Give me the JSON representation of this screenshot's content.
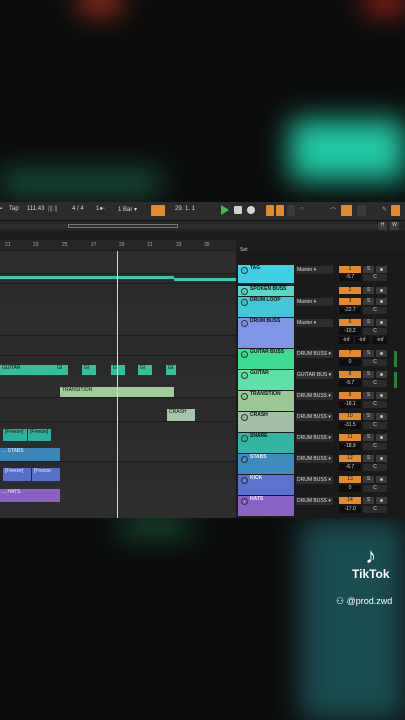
{
  "transport": {
    "tap": "Tap",
    "tempo": "111.43",
    "meter": "4 / 4",
    "quantize": "1 Bar",
    "position": "29.  1.  1"
  },
  "ruler": {
    "bars": [
      "21",
      "23",
      "25",
      "27",
      "29",
      "31",
      "33",
      "35"
    ]
  },
  "set_label": "Set",
  "clips": {
    "guitar": "GUITAR",
    "gi": "GI",
    "transition": "TRANSITION",
    "crash": "CRASH",
    "snare_a": "[Freeze]",
    "snare_b": "[Freeze]",
    "stabs": "... STABS",
    "kick_a": "[Freeze]",
    "kick_b": "[Freeze",
    "hats": "... HATS"
  },
  "tracks": [
    {
      "name": "TAG",
      "color": "#3fd0e6",
      "route": "Master",
      "num": "1",
      "vol": "-5.7",
      "pan": "C"
    },
    {
      "name": "SPOKEN BUSS",
      "color": "#57d7c6",
      "route": "",
      "num": "2",
      "vol": "",
      "pan": ""
    },
    {
      "name": "DRUM LOOP",
      "color": "#43c7d6",
      "route": "Master",
      "num": "3",
      "vol": "-22.7",
      "pan": "C"
    },
    {
      "name": "DRUM BUSS",
      "color": "#7f95e6",
      "route": "Master",
      "num": "6",
      "vol": "-10.2",
      "pan": "C",
      "extra": [
        "-inf",
        "-inf",
        "-inf"
      ]
    },
    {
      "name": "GUITAR BUSS",
      "color": "#3ddc90",
      "route": "DRUM BUSS",
      "num": "7",
      "vol": "0",
      "pan": "C"
    },
    {
      "name": "GUITAR",
      "color": "#5fe0a8",
      "route": "GUITAR BUS",
      "num": "8",
      "vol": "-5.7",
      "pan": "C"
    },
    {
      "name": "TRANSITION",
      "color": "#9cc896",
      "route": "DRUM BUSS",
      "num": "9",
      "vol": "-18.1",
      "pan": "C"
    },
    {
      "name": "CRASH",
      "color": "#a3bfa6",
      "route": "DRUM BUSS",
      "num": "10",
      "vol": "-31.5",
      "pan": "C"
    },
    {
      "name": "SNARE",
      "color": "#32b5a2",
      "route": "DRUM BUSS",
      "num": "11",
      "vol": "-18.9",
      "pan": "C"
    },
    {
      "name": "STABS",
      "color": "#3d8bbf",
      "route": "DRUM BUSS",
      "num": "12",
      "vol": "-6.7",
      "pan": "C"
    },
    {
      "name": "KICK",
      "color": "#5a73cf",
      "route": "DRUM BUSS",
      "num": "13",
      "vol": "0",
      "pan": "C"
    },
    {
      "name": "HATS",
      "color": "#8a63c4",
      "route": "DRUM BUSS",
      "num": "14",
      "vol": "-17.0",
      "pan": "C"
    }
  ],
  "solo_label": "S",
  "tiktok": {
    "brand": "TikTok",
    "handle": "@prod.zwd"
  }
}
